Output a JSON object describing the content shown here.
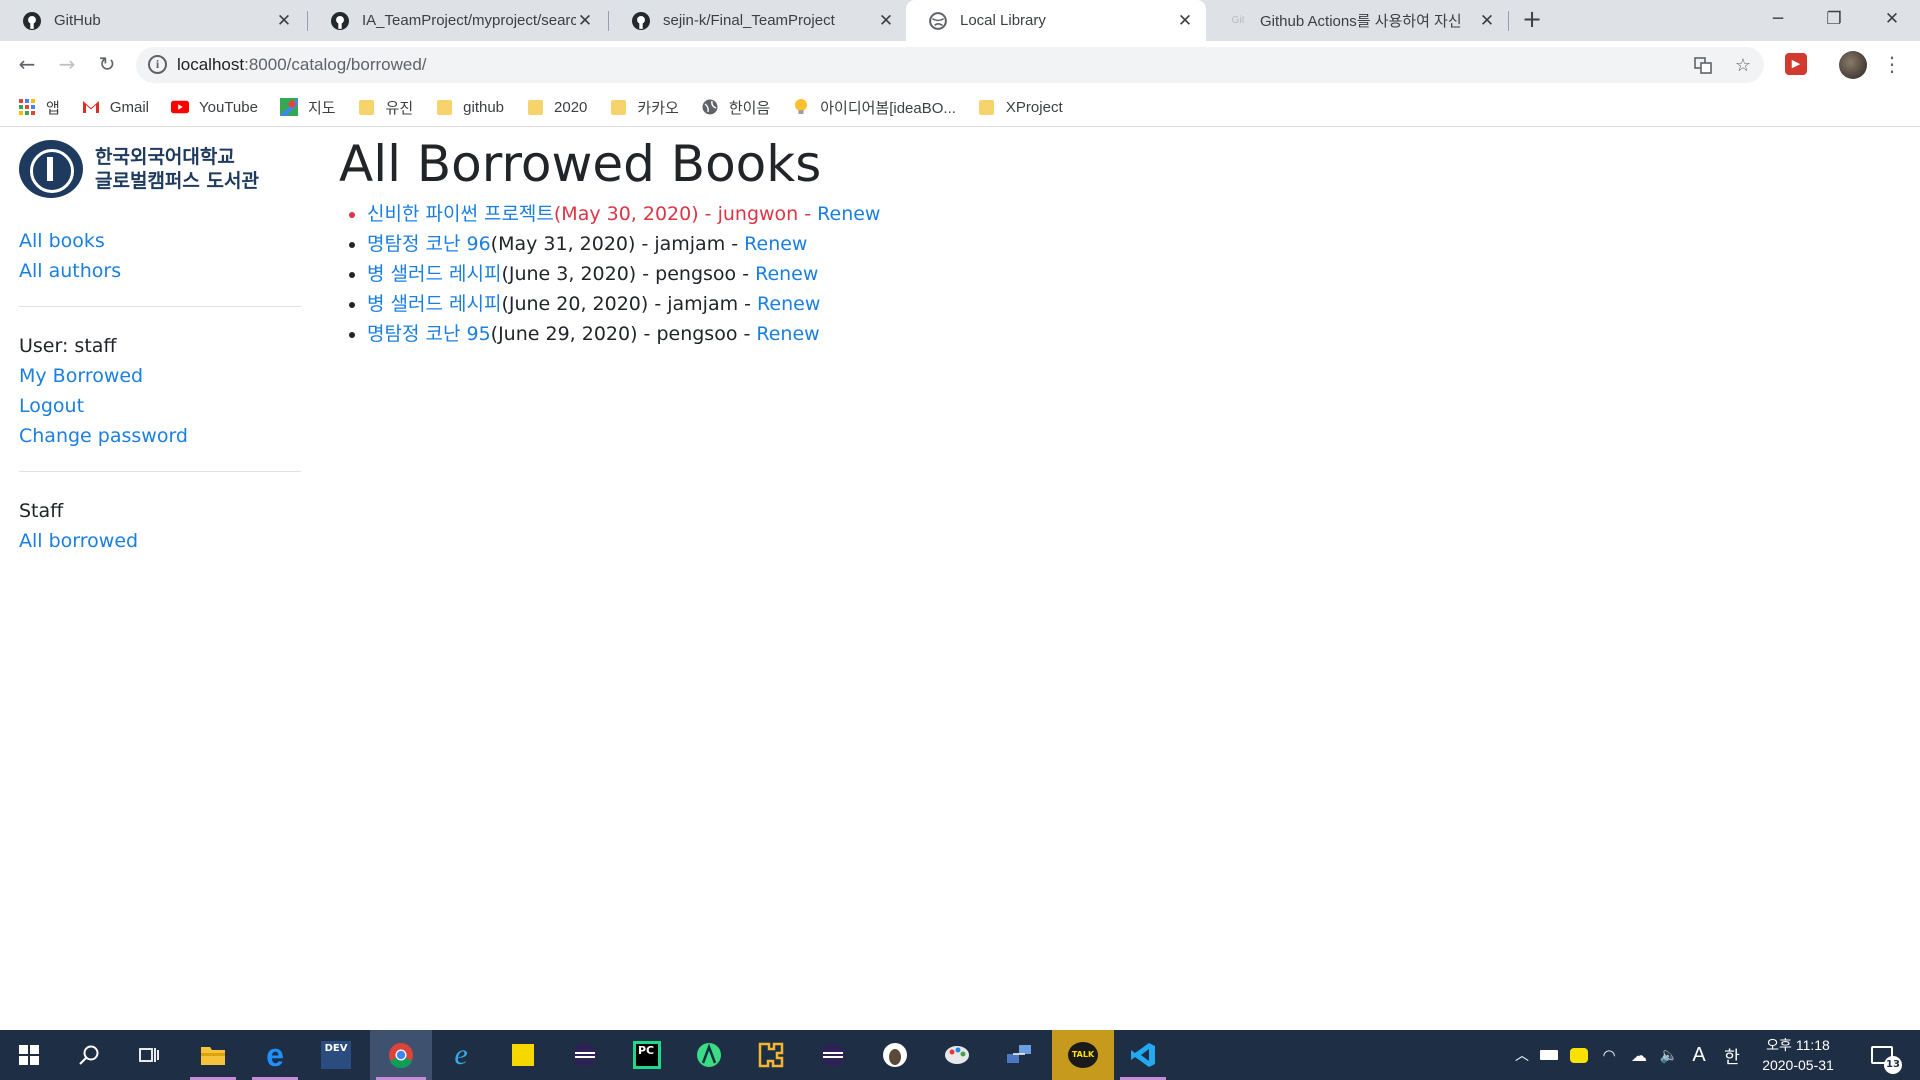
{
  "browser": {
    "tabs": [
      {
        "title": "GitHub",
        "icon": "github-icon",
        "active": false
      },
      {
        "title": "IA_TeamProject/myproject/searc",
        "icon": "github-icon",
        "active": false
      },
      {
        "title": "sejin-k/Final_TeamProject",
        "icon": "github-icon",
        "active": false
      },
      {
        "title": "Local Library",
        "icon": "globe-icon",
        "active": true
      },
      {
        "title": "Github Actions를 사용하여 자신",
        "icon": "site-icon",
        "active": false
      }
    ],
    "url_host": "localhost",
    "url_path": ":8000/catalog/borrowed/",
    "bookmarks": [
      {
        "label": "앱",
        "icon": "apps-icon"
      },
      {
        "label": "Gmail",
        "icon": "gmail-icon"
      },
      {
        "label": "YouTube",
        "icon": "youtube-icon"
      },
      {
        "label": "지도",
        "icon": "maps-icon"
      },
      {
        "label": "유진",
        "icon": "folder-icon"
      },
      {
        "label": "github",
        "icon": "folder-icon"
      },
      {
        "label": "2020",
        "icon": "folder-icon"
      },
      {
        "label": "카카오",
        "icon": "folder-icon"
      },
      {
        "label": "한이음",
        "icon": "globe-icon"
      },
      {
        "label": "아이디어봄[ideaBO...",
        "icon": "bulb-icon"
      },
      {
        "label": "XProject",
        "icon": "folder-icon"
      }
    ]
  },
  "sidebar": {
    "logo_line1": "한국외국어대학교",
    "logo_line2": "글로벌캠퍼스 도서관",
    "all_books": "All books",
    "all_authors": "All authors",
    "user_label": "User: staff",
    "my_borrowed": "My Borrowed",
    "logout": "Logout",
    "change_password": "Change password",
    "staff_label": "Staff",
    "all_borrowed": "All borrowed"
  },
  "main": {
    "title": "All Borrowed Books",
    "renew_label": "Renew",
    "books": [
      {
        "title": "신비한 파이썬 프로젝트",
        "due": "(May 30, 2020) - jungwon - ",
        "overdue": true
      },
      {
        "title": "명탐정 코난 96",
        "due": "(May 31, 2020) - jamjam - ",
        "overdue": false
      },
      {
        "title": "병 샐러드 레시피",
        "due": "(June 3, 2020) - pengsoo - ",
        "overdue": false
      },
      {
        "title": "병 샐러드 레시피",
        "due": "(June 20, 2020) - jamjam - ",
        "overdue": false
      },
      {
        "title": "명탐정 코난 95",
        "due": "(June 29, 2020) - pengsoo - ",
        "overdue": false
      }
    ]
  },
  "taskbar": {
    "time": "오후 11:18",
    "date": "2020-05-31",
    "notification_count": "13",
    "ime_a": "A",
    "ime_han": "한",
    "kakao_label": "TALK",
    "devenv_label": "DEV"
  },
  "colors": {
    "link": "#1b7fe0",
    "overdue": "#dc3545",
    "taskbar": "#1e2f45"
  }
}
